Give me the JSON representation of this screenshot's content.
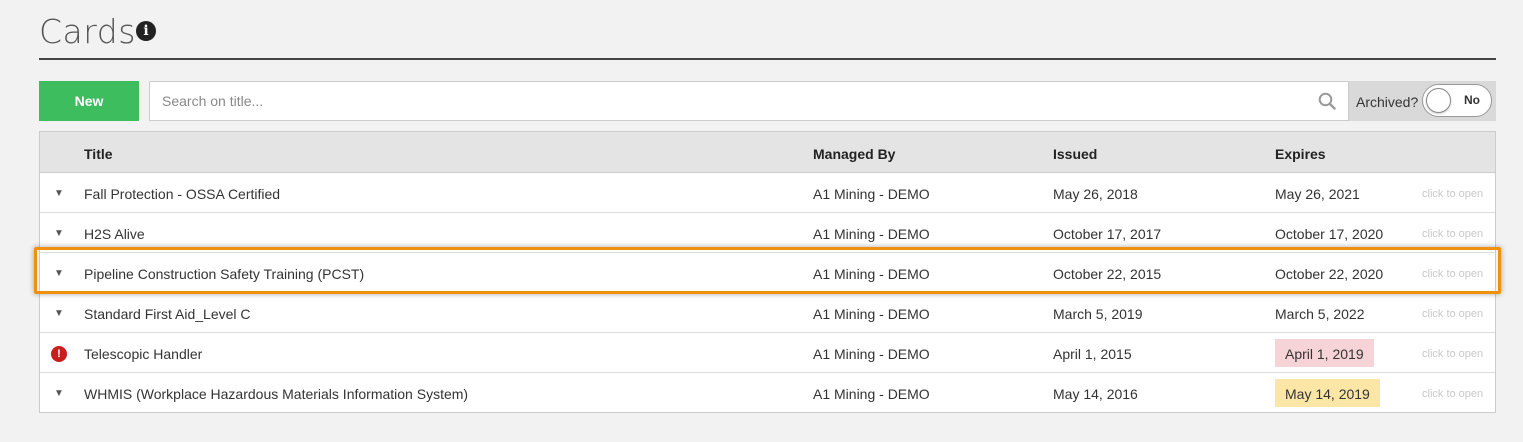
{
  "page": {
    "title": "Cards",
    "info_icon": "i"
  },
  "toolbar": {
    "new_label": "New",
    "search_placeholder": "Search on title...",
    "archived_label": "Archived?",
    "archived_toggle": "No"
  },
  "table": {
    "headers": {
      "title": "Title",
      "managed_by": "Managed By",
      "issued": "Issued",
      "expires": "Expires"
    },
    "rows": [
      {
        "indicator": "▼",
        "title": "Fall Protection - OSSA Certified",
        "managed_by": "A1 Mining - DEMO",
        "issued": "May 26, 2018",
        "expires": "May 26, 2021",
        "action": "click to open"
      },
      {
        "indicator": "▼",
        "title": "H2S Alive",
        "managed_by": "A1 Mining - DEMO",
        "issued": "October 17, 2017",
        "expires": "October 17, 2020",
        "action": "click to open"
      },
      {
        "indicator": "▼",
        "title": "Pipeline Construction Safety Training (PCST)",
        "managed_by": "A1 Mining - DEMO",
        "issued": "October 22, 2015",
        "expires": "October 22, 2020",
        "action": "click to open"
      },
      {
        "indicator": "▼",
        "title": "Standard First Aid_Level C",
        "managed_by": "A1 Mining - DEMO",
        "issued": "March 5, 2019",
        "expires": "March 5, 2022",
        "action": "click to open"
      },
      {
        "indicator": "!",
        "title": "Telescopic Handler",
        "managed_by": "A1 Mining - DEMO",
        "issued": "April 1, 2015",
        "expires": "April 1, 2019",
        "action": "click to open"
      },
      {
        "indicator": "▼",
        "title": "WHMIS (Workplace Hazardous Materials Information System)",
        "managed_by": "A1 Mining - DEMO",
        "issued": "May 14, 2016",
        "expires": "May 14, 2019",
        "action": "click to open"
      }
    ]
  },
  "colors": {
    "new_button": "#3dbd5d",
    "expired_badge": "#f6d3d6",
    "expiring_badge": "#fbe6a6",
    "alert": "#c81e1e",
    "highlight": "#f0900f"
  }
}
